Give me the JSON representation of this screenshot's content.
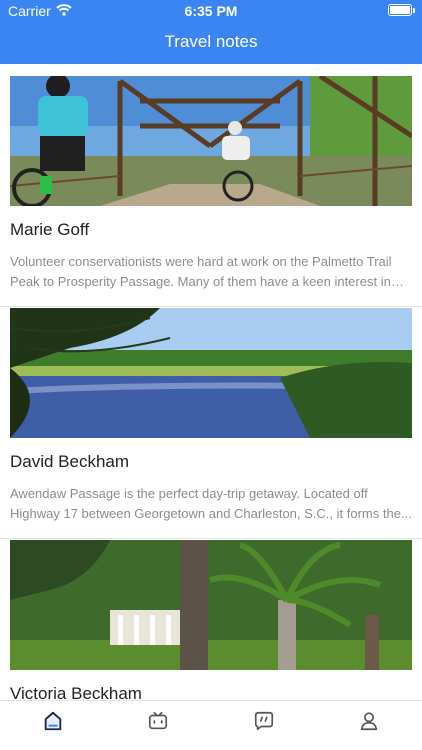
{
  "status_bar": {
    "carrier": "Carrier",
    "time": "6:35 PM"
  },
  "nav": {
    "title": "Travel notes"
  },
  "notes": [
    {
      "author": " Marie Goff",
      "description": "Volunteer conservationists were hard at work on the Palmetto Trail Peak to Prosperity Passage. Many of them have a keen interest in h..."
    },
    {
      "author": "David Beckham",
      "description": "Awendaw Passage is the perfect day-trip getaway. Located off Highway 17 between Georgetown and Charleston, S.C., it forms the..."
    },
    {
      "author": "Victoria Beckham",
      "description": ""
    }
  ],
  "tabs": [
    {
      "icon": "home-icon",
      "active": true
    },
    {
      "icon": "tv-icon",
      "active": false
    },
    {
      "icon": "message-icon",
      "active": false
    },
    {
      "icon": "profile-icon",
      "active": false
    }
  ],
  "colors": {
    "accent": "#3a85f2",
    "text_primary": "#222222",
    "text_secondary": "#8c8c8c"
  }
}
